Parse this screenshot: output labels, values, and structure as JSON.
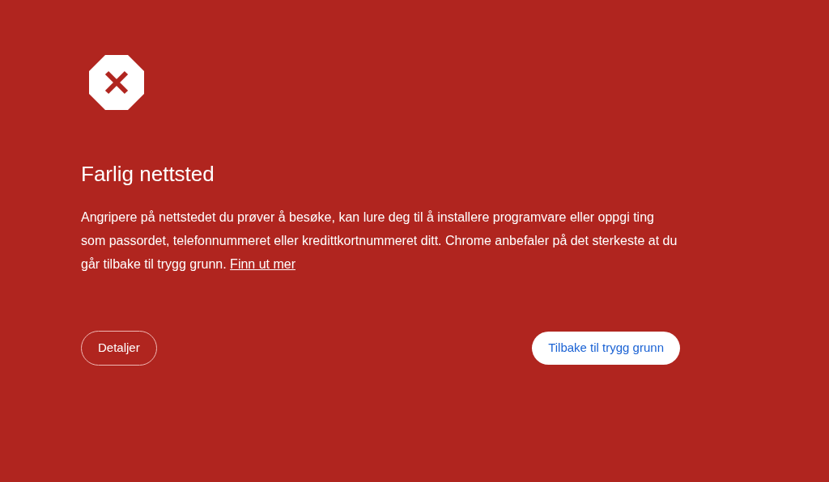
{
  "title": "Farlig nettsted",
  "body": {
    "text": "Angripere på nettstedet du prøver å besøke, kan lure deg til å installere programvare eller oppgi ting som passordet, telefonnummeret eller kredittkortnummeret ditt. Chrome anbefaler på det sterkeste at du går tilbake til trygg grunn.",
    "link": "Finn ut mer"
  },
  "buttons": [
    {
      "label": "Detaljer",
      "kind": "outline"
    },
    {
      "label": "Tilbake til trygg grunn",
      "kind": "primary"
    }
  ]
}
